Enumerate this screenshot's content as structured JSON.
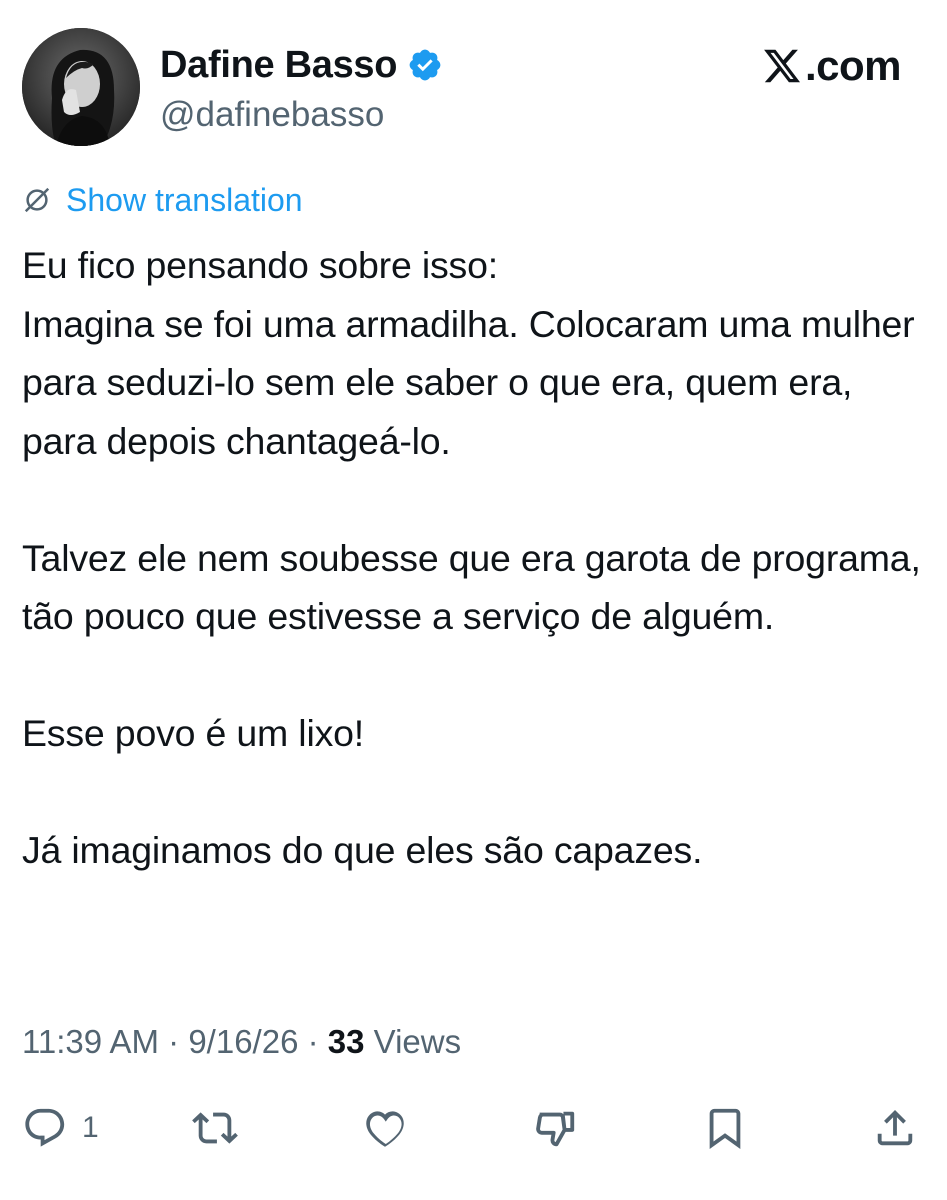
{
  "author": {
    "display_name": "Dafine Basso",
    "handle": "@dafinebasso",
    "verified": true,
    "avatar_icon": "profile-photo"
  },
  "brand": {
    "label": ".com",
    "icon": "x-logo-icon"
  },
  "translation": {
    "label": "Show translation",
    "icon": "globe-translate-icon"
  },
  "tweet": {
    "paragraphs": [
      "Eu fico pensando sobre isso:\nImagina se foi uma armadilha. Colocaram uma mulher para seduzi-lo sem ele saber o que era, quem era, para depois chantageá-lo.",
      "Talvez ele nem soubesse que era garota de programa, tão pouco que estivesse a serviço de alguém.",
      "Esse povo é um lixo!",
      "Já imaginamos do que eles são capazes."
    ]
  },
  "meta": {
    "time": "11:39 AM",
    "separator": "·",
    "date": "9/16/26",
    "views_count": "33",
    "views_label": "Views"
  },
  "actions": {
    "reply_count": "1",
    "reply_icon": "reply-icon",
    "retweet_icon": "retweet-icon",
    "like_icon": "heart-icon",
    "dislike_icon": "downvote-icon",
    "bookmark_icon": "bookmark-icon",
    "share_icon": "share-icon"
  },
  "colors": {
    "link": "#1d9bf0",
    "secondary_text": "#536471",
    "primary_text": "#0f1419",
    "verified": "#1d9bf0"
  }
}
